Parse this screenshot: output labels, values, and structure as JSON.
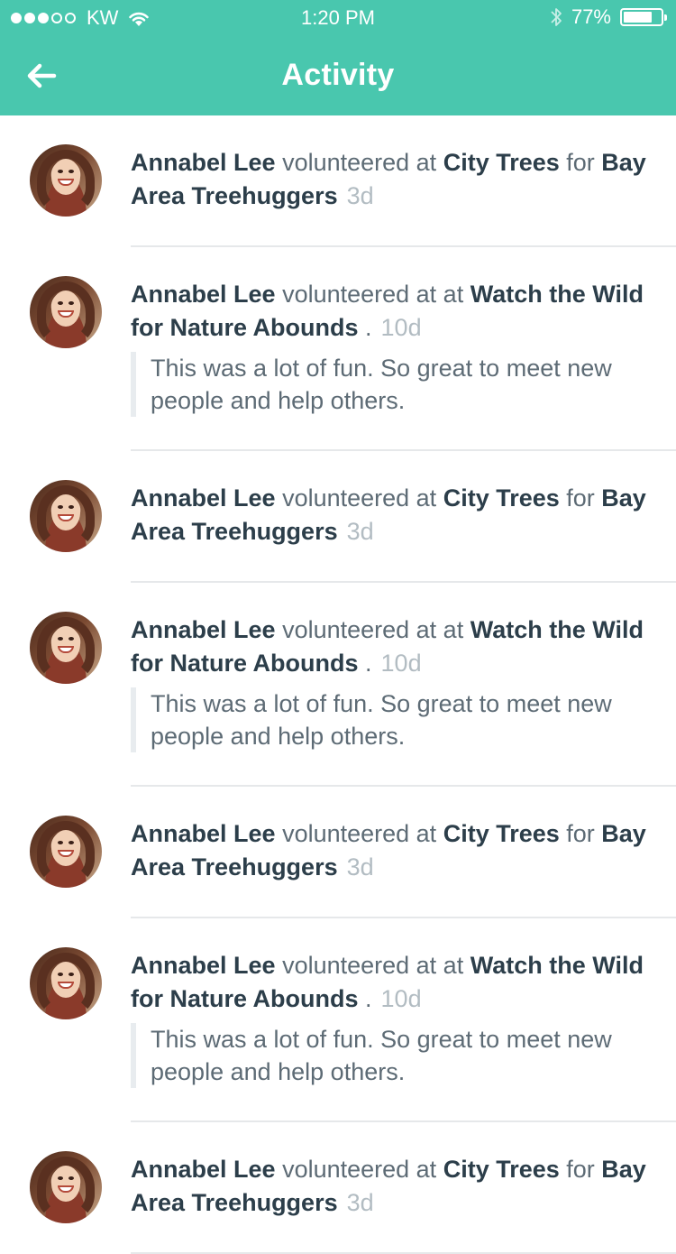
{
  "status_bar": {
    "carrier": "KW",
    "time": "1:20 PM",
    "battery": "77%",
    "battery_level": 0.77,
    "signal_bars_filled": 3,
    "signal_bars_total": 5
  },
  "header": {
    "title": "Activity",
    "back_icon": "arrow-left-icon"
  },
  "activity": [
    {
      "name": "Annabel Lee",
      "verb": "volunteered at",
      "event": "City Trees",
      "connector": "for",
      "org": "Bay Area Treehuggers",
      "time": "3d",
      "comment": ""
    },
    {
      "name": "Annabel Lee",
      "verb": "volunteered at at",
      "event": "Watch the Wild for Nature Abounds",
      "connector": "",
      "org": "",
      "time": "10d",
      "comment": "This was a lot of fun. So great to meet new people and help others."
    },
    {
      "name": "Annabel Lee",
      "verb": "volunteered at",
      "event": "City Trees",
      "connector": "for",
      "org": "Bay Area Treehuggers",
      "time": "3d",
      "comment": ""
    },
    {
      "name": "Annabel Lee",
      "verb": "volunteered at at",
      "event": "Watch the Wild for Nature Abounds",
      "connector": "",
      "org": "",
      "time": "10d",
      "comment": "This was a lot of fun. So great to meet new people and help others."
    },
    {
      "name": "Annabel Lee",
      "verb": "volunteered at",
      "event": "City Trees",
      "connector": "for",
      "org": "Bay Area Treehuggers",
      "time": "3d",
      "comment": ""
    },
    {
      "name": "Annabel Lee",
      "verb": "volunteered at at",
      "event": "Watch the Wild for Nature Abounds",
      "connector": "",
      "org": "",
      "time": "10d",
      "comment": "This was a lot of fun. So great to meet new people and help others."
    },
    {
      "name": "Annabel Lee",
      "verb": "volunteered at",
      "event": "City Trees",
      "connector": "for",
      "org": "Bay Area Treehuggers",
      "time": "3d",
      "comment": ""
    }
  ],
  "colors": {
    "accent": "#49c7ae",
    "text_strong": "#2c3e4a",
    "text_muted": "#5d6b75",
    "timestamp": "#b2bcc2",
    "divider": "#e6e8ea"
  }
}
